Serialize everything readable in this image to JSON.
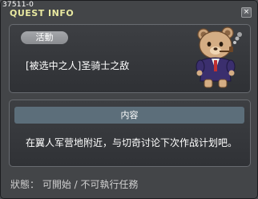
{
  "window": {
    "id": "37511-0",
    "title": "QUEST INFO",
    "close_icon": "×"
  },
  "quest": {
    "category": "活動",
    "name": "[被选中之人]圣骑士之敌"
  },
  "content": {
    "header": "内容",
    "text": "在翼人军营地附近，与切奇讨论下次作战计划吧。"
  },
  "status": {
    "label": "狀態：",
    "value": "可開始 / 不可執行任務"
  },
  "colors": {
    "title": "#e8e8a0",
    "header_bar": "#5c6e7a",
    "pill": "#9a9c9f"
  }
}
